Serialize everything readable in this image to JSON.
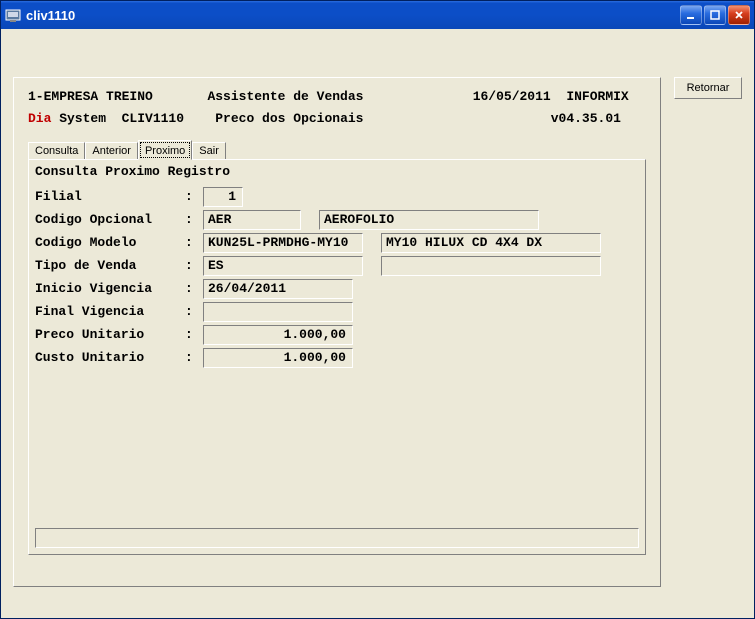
{
  "window": {
    "title": "cliv1110"
  },
  "sidebar": {
    "retornar": "Retornar"
  },
  "header": {
    "line1_left": "1-EMPRESA TREINO",
    "line1_center": "Assistente de Vendas",
    "line1_date": "16/05/2011",
    "line1_db": "INFORMIX",
    "line2_left_red": "Dia",
    "line2_left_rest": " System  CLIV1110",
    "line2_center": "Preco dos Opcionais",
    "line2_ver": "v04.35.01"
  },
  "tabs": {
    "consulta": "Consulta",
    "anterior": "Anterior",
    "proximo": "Proximo",
    "sair": "Sair"
  },
  "form": {
    "subtitle": "Consulta Proximo Registro",
    "labels": {
      "filial": "Filial",
      "cod_opcional": "Codigo Opcional",
      "cod_modelo": "Codigo Modelo",
      "tipo_venda": "Tipo de Venda",
      "ini_vig": "Inicio Vigencia",
      "fim_vig": "Final Vigencia",
      "preco_unit": "Preco Unitario",
      "custo_unit": "Custo Unitario"
    },
    "values": {
      "filial": "1",
      "cod_opcional": "AER",
      "desc_opcional": "AEROFOLIO",
      "cod_modelo": "KUN25L-PRMDHG-MY10",
      "desc_modelo": "MY10 HILUX CD 4X4 DX",
      "tipo_venda": "ES",
      "desc_tipo_venda": "",
      "ini_vig": "26/04/2011",
      "fim_vig": "",
      "preco_unit": "1.000,00",
      "custo_unit": "1.000,00"
    }
  }
}
